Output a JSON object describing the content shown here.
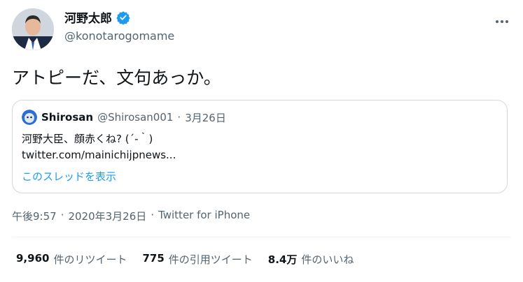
{
  "author": {
    "name": "河野太郎",
    "handle": "@konotarogomame"
  },
  "tweet": {
    "text": "アトピーだ、文句あっか。"
  },
  "quoted_tweet": {
    "name": "Shirosan",
    "handle": "@Shirosan001",
    "separator": "·",
    "date": "3月26日",
    "text_line1": "河野大臣、顔赤くね? (´-｀)",
    "text_line2": "twitter.com/mainichijpnews...",
    "thread_link": "このスレッドを表示"
  },
  "meta": {
    "time": "午後9:57",
    "sep1": "·",
    "date": "2020年3月26日",
    "sep2": "·",
    "source": "Twitter for iPhone"
  },
  "stats": {
    "retweets_count": "9,960",
    "retweets_label": "件のリツイート",
    "quotes_count": "775",
    "quotes_label": "件の引用ツイート",
    "likes_count": "8.4万",
    "likes_label": "件のいいね"
  },
  "colors": {
    "accent": "#1d9bf0",
    "muted": "#536471",
    "border": "#cfd9de"
  }
}
